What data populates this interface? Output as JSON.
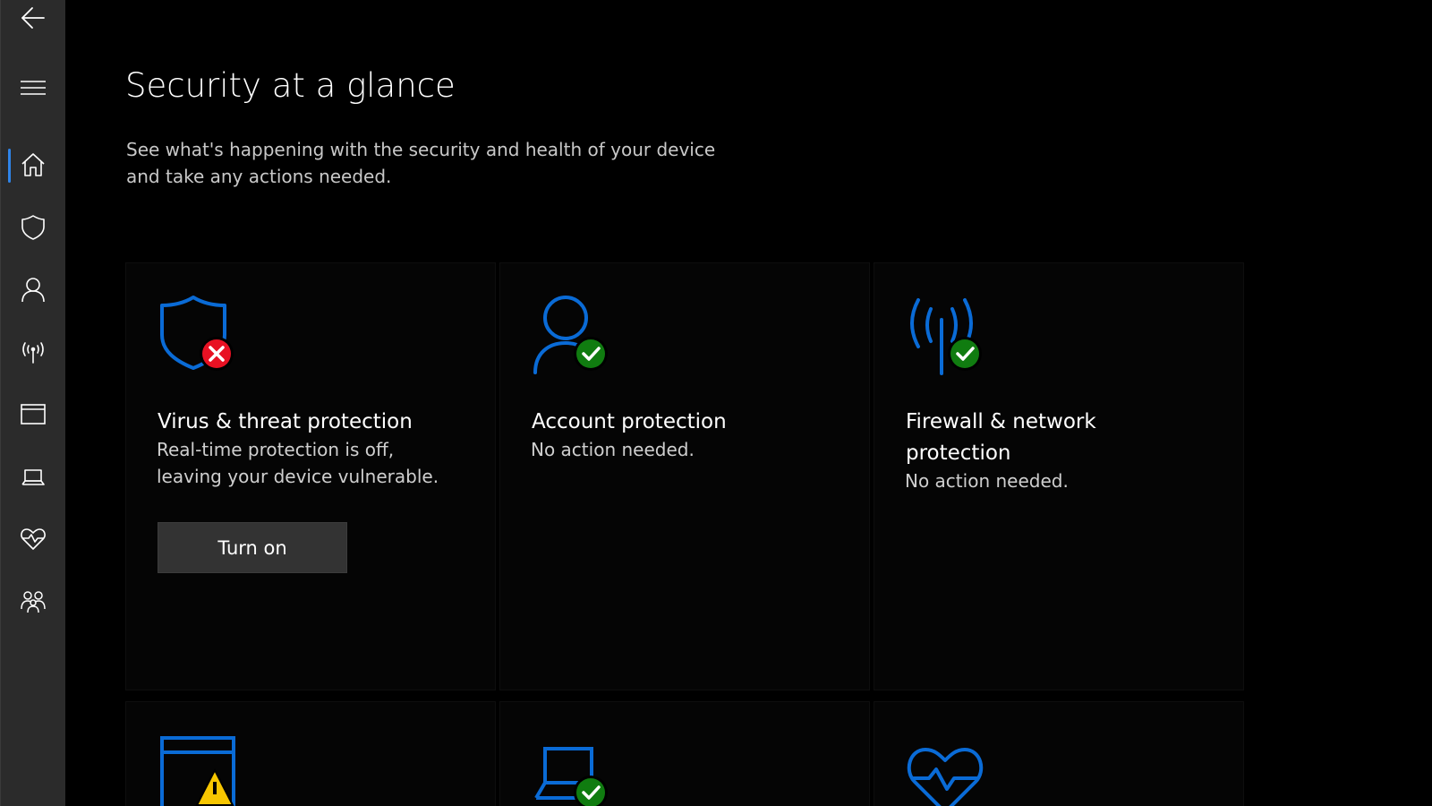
{
  "page": {
    "title": "Security at a glance",
    "subtitle_line1": "See what's happening with the security and health of your device",
    "subtitle_line2": "and take any actions needed."
  },
  "sidebar": {
    "items": [
      {
        "icon": "back-arrow-icon"
      },
      {
        "icon": "hamburger-menu-icon"
      },
      {
        "icon": "home-icon",
        "active": true
      },
      {
        "icon": "shield-icon"
      },
      {
        "icon": "person-icon"
      },
      {
        "icon": "wireless-antenna-icon"
      },
      {
        "icon": "app-browser-window-icon"
      },
      {
        "icon": "laptop-icon"
      },
      {
        "icon": "heart-health-icon"
      },
      {
        "icon": "family-icon"
      }
    ]
  },
  "tiles": [
    {
      "title": "Virus & threat protection",
      "desc_line1": "Real-time protection is off,",
      "desc_line2": "leaving your device vulnerable.",
      "button_label": "Turn on",
      "status": "error"
    },
    {
      "title": "Account protection",
      "desc_line1": "No action needed.",
      "status": "ok"
    },
    {
      "title_line1": "Firewall & network",
      "title_line2": "protection",
      "desc_line1": "No action needed.",
      "status": "ok"
    },
    {
      "status": "warning"
    },
    {
      "status": "ok"
    },
    {
      "status": "none"
    }
  ],
  "colors": {
    "accent_blue": "#0a6bd6",
    "ok_green": "#107c10",
    "error_red": "#e81123",
    "warning_yellow": "#f7c600",
    "sidebar_bg": "#2b2b2b"
  }
}
